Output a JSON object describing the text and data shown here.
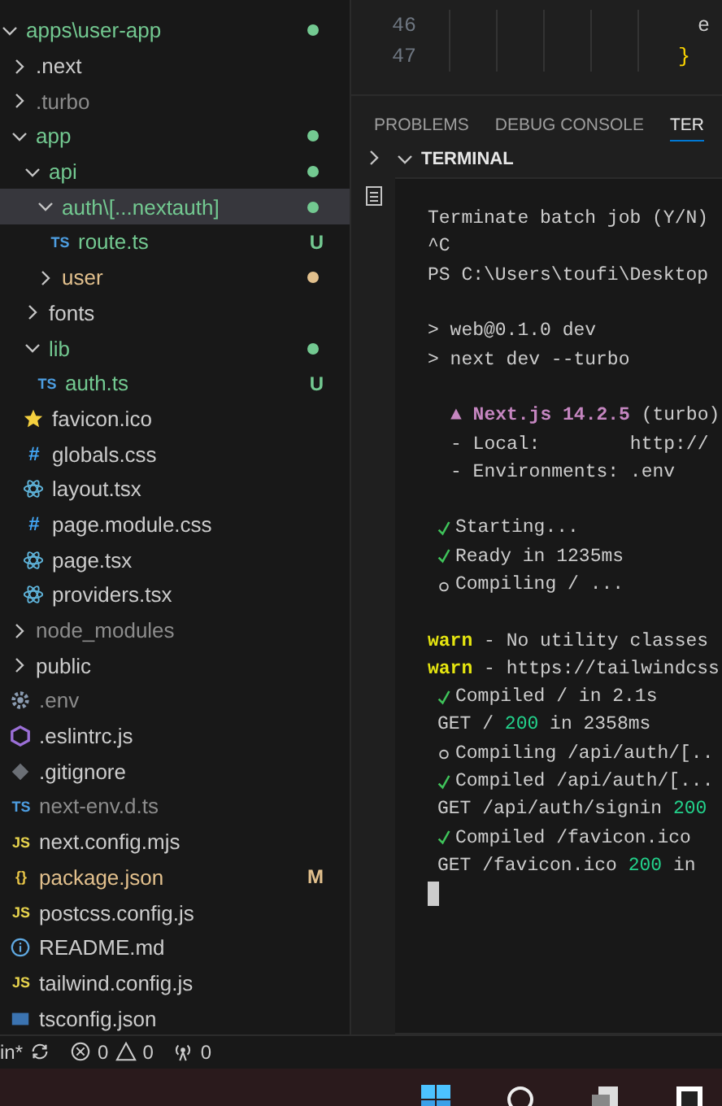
{
  "explorer": {
    "tree": [
      {
        "name": "apps\\user-app",
        "kind": "folder",
        "expanded": true,
        "selected": false,
        "color": "#73c991",
        "children": [
          {
            "name": ".next",
            "kind": "folder",
            "expanded": false,
            "selected": false,
            "color": "#cccccc"
          },
          {
            "name": ".turbo",
            "kind": "folder",
            "expanded": false,
            "selected": false,
            "color": "#8c8c8c"
          },
          {
            "name": "app",
            "kind": "folder",
            "expanded": true,
            "selected": false,
            "color": "#73c991",
            "children": [
              {
                "name": "api",
                "kind": "folder",
                "expanded": true,
                "selected": false,
                "color": "#73c991",
                "children": [
                  {
                    "name": "auth\\[...nextauth]",
                    "kind": "folder",
                    "expanded": true,
                    "selected": true,
                    "color": "#73c991",
                    "children": [
                      {
                        "name": "route.ts",
                        "kind": "glyph",
                        "glyph": "TS",
                        "selected": false,
                        "color": "#73c991",
                        "badge": "U"
                      }
                    ]
                  },
                  {
                    "name": "user",
                    "kind": "folder",
                    "expanded": false,
                    "selected": false,
                    "color": "#e2c08d"
                  }
                ]
              },
              {
                "name": "fonts",
                "kind": "folder",
                "expanded": false,
                "selected": false,
                "color": "#cccccc"
              },
              {
                "name": "lib",
                "kind": "folder",
                "expanded": true,
                "selected": false,
                "color": "#73c991",
                "children": [
                  {
                    "name": "auth.ts",
                    "kind": "glyph",
                    "glyph": "TS",
                    "selected": false,
                    "color": "#73c991",
                    "badge": "U"
                  }
                ]
              },
              {
                "name": "favicon.ico",
                "kind": "star",
                "selected": false,
                "color": "#cccccc"
              },
              {
                "name": "globals.css",
                "kind": "glyph",
                "glyph": "#",
                "selected": false,
                "color": "#cccccc"
              },
              {
                "name": "layout.tsx",
                "kind": "react",
                "selected": false,
                "color": "#cccccc"
              },
              {
                "name": "page.module.css",
                "kind": "glyph",
                "glyph": "#",
                "selected": false,
                "color": "#cccccc"
              },
              {
                "name": "page.tsx",
                "kind": "react",
                "selected": false,
                "color": "#cccccc"
              },
              {
                "name": "providers.tsx",
                "kind": "react",
                "selected": false,
                "color": "#cccccc"
              }
            ]
          },
          {
            "name": "node_modules",
            "kind": "folder",
            "expanded": false,
            "selected": false,
            "color": "#8c8c8c"
          },
          {
            "name": "public",
            "kind": "folder",
            "expanded": false,
            "selected": false,
            "color": "#cccccc"
          },
          {
            "name": ".env",
            "kind": "gear",
            "selected": false,
            "color": "#8c8c8c"
          },
          {
            "name": ".eslintrc.js",
            "kind": "hexagon",
            "selected": false,
            "color": "#cccccc"
          },
          {
            "name": ".gitignore",
            "kind": "diamond",
            "selected": false,
            "color": "#cccccc"
          },
          {
            "name": "next-env.d.ts",
            "kind": "glyph",
            "glyph": "TS",
            "selected": false,
            "color": "#8c8c8c"
          },
          {
            "name": "next.config.mjs",
            "kind": "glyph",
            "glyph": "JS",
            "selected": false,
            "color": "#cccccc"
          },
          {
            "name": "package.json",
            "kind": "glyph",
            "glyph": "{}",
            "selected": false,
            "color": "#e2c08d",
            "badge": "M"
          },
          {
            "name": "postcss.config.js",
            "kind": "glyph",
            "glyph": "JS",
            "selected": false,
            "color": "#cccccc"
          },
          {
            "name": "README.md",
            "kind": "info",
            "selected": false,
            "color": "#cccccc"
          },
          {
            "name": "tailwind.config.js",
            "kind": "glyph",
            "glyph": "JS",
            "selected": false,
            "color": "#cccccc"
          },
          {
            "name": "tsconfig.json",
            "kind": "box",
            "selected": false,
            "color": "#cccccc"
          }
        ]
      }
    ]
  },
  "editor": {
    "lines": [
      {
        "number": "46",
        "code": "e",
        "kind": "plain"
      },
      {
        "number": "47",
        "code": "}",
        "kind": "brace"
      }
    ]
  },
  "panel_tabs": [
    {
      "label": "PROBLEMS",
      "selected": false
    },
    {
      "label": "DEBUG CONSOLE",
      "selected": false
    },
    {
      "label": "TER",
      "selected": true
    }
  ],
  "terminal": {
    "title": "TERMINAL",
    "lines": [
      {
        "kind": "plain",
        "parts": [
          {
            "text": "Terminate batch job (Y/N)",
            "kind": "normal"
          }
        ]
      },
      {
        "kind": "plain",
        "parts": [
          {
            "text": "^C",
            "kind": "normal"
          }
        ]
      },
      {
        "kind": "plain",
        "parts": [
          {
            "text": "PS C:\\Users\\toufi\\Desktop",
            "kind": "normal"
          }
        ]
      },
      {
        "kind": "blank"
      },
      {
        "kind": "plain",
        "parts": [
          {
            "text": "> web@0.1.0 dev",
            "kind": "normal"
          }
        ]
      },
      {
        "kind": "plain",
        "parts": [
          {
            "text": "> next dev --turbo",
            "kind": "normal"
          }
        ]
      },
      {
        "kind": "blank"
      },
      {
        "kind": "info",
        "parts": [
          {
            "text": "▲ Next.js 14.2.5",
            "kind": "accent"
          },
          {
            "text": " (turbo)",
            "kind": "normal"
          }
        ]
      },
      {
        "kind": "info",
        "parts": [
          {
            "text": "- Local:        http://",
            "kind": "normal"
          }
        ]
      },
      {
        "kind": "info",
        "parts": [
          {
            "text": "- Environments: .env",
            "kind": "normal"
          }
        ]
      },
      {
        "kind": "blank"
      },
      {
        "kind": "check",
        "parts": [
          {
            "text": "Starting...",
            "kind": "normal"
          }
        ]
      },
      {
        "kind": "check",
        "parts": [
          {
            "text": "Ready in 1235ms",
            "kind": "normal"
          }
        ]
      },
      {
        "kind": "circle",
        "parts": [
          {
            "text": "Compiling / ...",
            "kind": "normal"
          }
        ]
      },
      {
        "kind": "blank"
      },
      {
        "kind": "plain",
        "parts": [
          {
            "text": "warn",
            "kind": "warn"
          },
          {
            "text": " - No utility classes",
            "kind": "normal"
          }
        ]
      },
      {
        "kind": "plain",
        "parts": [
          {
            "text": "warn",
            "kind": "warn"
          },
          {
            "text": " - https://tailwindcss",
            "kind": "normal"
          }
        ]
      },
      {
        "kind": "check",
        "parts": [
          {
            "text": "Compiled / in 2.1s",
            "kind": "normal"
          }
        ]
      },
      {
        "kind": "status",
        "parts": [
          {
            "text": "GET / ",
            "kind": "normal"
          },
          {
            "text": "200",
            "kind": "ok"
          },
          {
            "text": " in 2358ms",
            "kind": "normal"
          }
        ]
      },
      {
        "kind": "circle",
        "parts": [
          {
            "text": "Compiling /api/auth/[..",
            "kind": "normal"
          }
        ]
      },
      {
        "kind": "check",
        "parts": [
          {
            "text": "Compiled /api/auth/[...",
            "kind": "normal"
          }
        ]
      },
      {
        "kind": "status",
        "parts": [
          {
            "text": "GET /api/auth/signin ",
            "kind": "normal"
          },
          {
            "text": "200",
            "kind": "ok"
          }
        ]
      },
      {
        "kind": "check",
        "parts": [
          {
            "text": "Compiled /favicon.ico",
            "kind": "normal"
          }
        ]
      },
      {
        "kind": "status",
        "parts": [
          {
            "text": "GET /favicon.ico ",
            "kind": "normal"
          },
          {
            "text": "200",
            "kind": "ok"
          },
          {
            "text": " in",
            "kind": "normal"
          }
        ]
      },
      {
        "kind": "cursor"
      }
    ]
  },
  "status_bar": {
    "branch": "in*",
    "errors": "0",
    "warnings": "0",
    "ports": "0"
  }
}
